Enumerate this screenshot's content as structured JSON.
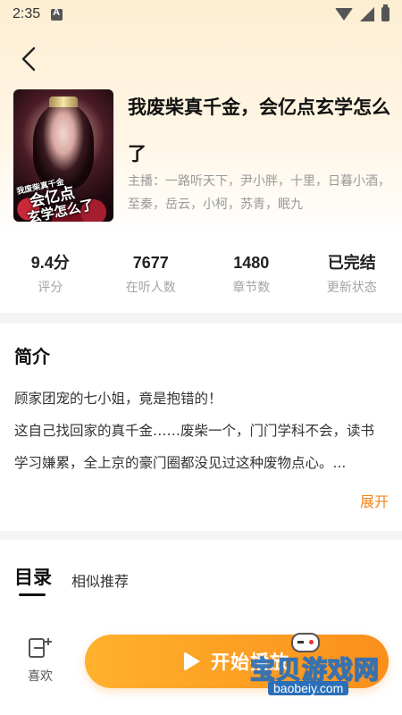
{
  "status_bar": {
    "time": "2:35"
  },
  "book": {
    "title": "我废柴真千金，会亿点玄学怎么了",
    "cover_text_line1": "我废柴真千金",
    "cover_text_line2": "会亿点",
    "cover_text_line3": "玄学怎么了",
    "hosts": "主播：一路听天下，尹小胖，十里，日暮小酒，至秦，岳云，小柯，苏青，眠九"
  },
  "stats": [
    {
      "value": "9.4分",
      "label": "评分"
    },
    {
      "value": "7677",
      "label": "在听人数"
    },
    {
      "value": "1480",
      "label": "章节数"
    },
    {
      "value": "已完结",
      "label": "更新状态"
    }
  ],
  "intro": {
    "heading": "简介",
    "lines": [
      "顾家团宠的七小姐，竟是抱错的！",
      "这自己找回家的真千金……废柴一个，门门学科不会，读书学习嫌累，全上京的豪门圈都没见过这种废物点心。..."
    ],
    "expand_label": "展开"
  },
  "tabs": [
    {
      "label": "目录",
      "active": true
    },
    {
      "label": "相似推荐",
      "active": false
    }
  ],
  "bottom": {
    "like_label": "喜欢",
    "play_label": "开始播放"
  },
  "watermark": {
    "text": "宝贝游戏网",
    "url": "baobeiy.com"
  },
  "colors": {
    "accent": "#f1861f",
    "play_start": "#ffb12c",
    "play_end": "#fa8f1c"
  }
}
